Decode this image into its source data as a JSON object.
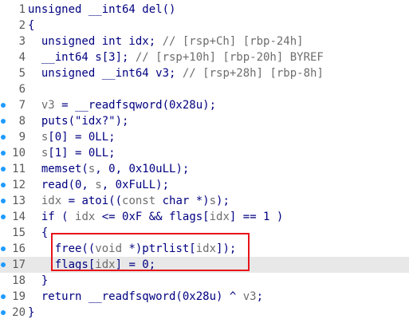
{
  "editor": {
    "lines": [
      {
        "n": "1",
        "bp": false,
        "current": false,
        "segs": [
          {
            "t": "unsigned __int64 del()",
            "g": false
          }
        ]
      },
      {
        "n": "2",
        "bp": false,
        "current": false,
        "segs": [
          {
            "t": "{",
            "g": false
          }
        ]
      },
      {
        "n": "3",
        "bp": false,
        "current": false,
        "segs": [
          {
            "t": "  unsigned int idx; ",
            "g": false
          },
          {
            "t": "// [rsp+Ch] [rbp-24h]",
            "g": true
          }
        ]
      },
      {
        "n": "4",
        "bp": false,
        "current": false,
        "segs": [
          {
            "t": "  __int64 s[3]; ",
            "g": false
          },
          {
            "t": "// [rsp+10h] [rbp-20h] BYREF",
            "g": true
          }
        ]
      },
      {
        "n": "5",
        "bp": false,
        "current": false,
        "segs": [
          {
            "t": "  unsigned __int64 v3; ",
            "g": false
          },
          {
            "t": "// [rsp+28h] [rbp-8h]",
            "g": true
          }
        ]
      },
      {
        "n": "6",
        "bp": false,
        "current": false,
        "segs": [
          {
            "t": "",
            "g": false
          }
        ]
      },
      {
        "n": "7",
        "bp": true,
        "current": false,
        "segs": [
          {
            "t": "  ",
            "g": false
          },
          {
            "t": "v3",
            "g": true
          },
          {
            "t": " = __readfsqword(0x28u);",
            "g": false
          }
        ]
      },
      {
        "n": "8",
        "bp": true,
        "current": false,
        "segs": [
          {
            "t": "  puts(\"idx?\");",
            "g": false
          }
        ]
      },
      {
        "n": "9",
        "bp": true,
        "current": false,
        "segs": [
          {
            "t": "  ",
            "g": false
          },
          {
            "t": "s",
            "g": true
          },
          {
            "t": "[0] = 0LL;",
            "g": false
          }
        ]
      },
      {
        "n": "10",
        "bp": true,
        "current": false,
        "segs": [
          {
            "t": "  ",
            "g": false
          },
          {
            "t": "s",
            "g": true
          },
          {
            "t": "[1] = 0LL;",
            "g": false
          }
        ]
      },
      {
        "n": "11",
        "bp": true,
        "current": false,
        "segs": [
          {
            "t": "  memset(",
            "g": false
          },
          {
            "t": "s",
            "g": true
          },
          {
            "t": ", 0, 0x10uLL);",
            "g": false
          }
        ]
      },
      {
        "n": "12",
        "bp": true,
        "current": false,
        "segs": [
          {
            "t": "  read(0, ",
            "g": false
          },
          {
            "t": "s",
            "g": true
          },
          {
            "t": ", 0xFuLL);",
            "g": false
          }
        ]
      },
      {
        "n": "13",
        "bp": true,
        "current": false,
        "segs": [
          {
            "t": "  ",
            "g": false
          },
          {
            "t": "idx",
            "g": true
          },
          {
            "t": " = atoi((",
            "g": false
          },
          {
            "t": "const",
            "g": true
          },
          {
            "t": " char *)",
            "g": false
          },
          {
            "t": "s",
            "g": true
          },
          {
            "t": ");",
            "g": false
          }
        ]
      },
      {
        "n": "14",
        "bp": true,
        "current": false,
        "segs": [
          {
            "t": "  if ( ",
            "g": false
          },
          {
            "t": "idx",
            "g": true
          },
          {
            "t": " <= 0xF && flags[",
            "g": false
          },
          {
            "t": "idx",
            "g": true
          },
          {
            "t": "] == 1 )",
            "g": false
          }
        ]
      },
      {
        "n": "15",
        "bp": false,
        "current": false,
        "segs": [
          {
            "t": "  {",
            "g": false
          }
        ]
      },
      {
        "n": "16",
        "bp": true,
        "current": false,
        "segs": [
          {
            "t": "    free((",
            "g": false
          },
          {
            "t": "void",
            "g": true
          },
          {
            "t": " *)ptrlist[",
            "g": false
          },
          {
            "t": "idx",
            "g": true
          },
          {
            "t": "]);",
            "g": false
          }
        ]
      },
      {
        "n": "17",
        "bp": true,
        "current": true,
        "segs": [
          {
            "t": "    flags[",
            "g": false
          },
          {
            "t": "idx",
            "g": true
          },
          {
            "t": "] = 0;",
            "g": false
          }
        ]
      },
      {
        "n": "18",
        "bp": false,
        "current": false,
        "segs": [
          {
            "t": "  }",
            "g": false
          }
        ]
      },
      {
        "n": "19",
        "bp": true,
        "current": false,
        "segs": [
          {
            "t": "  return __readfsqword(0x28u) ^ ",
            "g": false
          },
          {
            "t": "v3",
            "g": true
          },
          {
            "t": ";",
            "g": false
          }
        ]
      },
      {
        "n": "20",
        "bp": true,
        "current": false,
        "segs": [
          {
            "t": "}",
            "g": false
          }
        ]
      }
    ]
  },
  "colors": {
    "code": "#000080",
    "variable": "#6d6d6d",
    "line_number": "#5a5a5a",
    "breakpoint_dot": "#1e9bff",
    "current_line": "#e8e8e8",
    "highlight_box": "#e8141a"
  },
  "icons": {
    "breakpoint": "breakpoint-dot-icon"
  }
}
